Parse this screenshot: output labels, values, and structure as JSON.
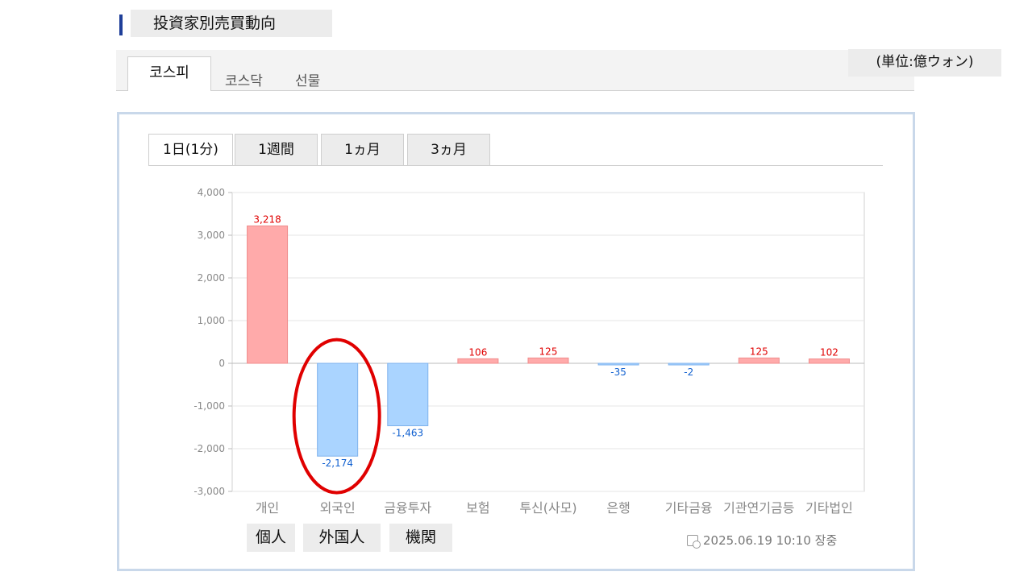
{
  "header": {
    "title": "投資家別売買動向"
  },
  "market_tabs": [
    "코스피",
    "코스닥",
    "선물"
  ],
  "unit_label": "(単位:億ウォン)",
  "period_tabs": [
    "1日(1分)",
    "1週間",
    "1ヵ月",
    "3ヵ月"
  ],
  "captions": [
    "個人",
    "外国人",
    "機関"
  ],
  "timestamp": "2025.06.19 10:10 장중",
  "colors": {
    "positive_fill": "#ffaaaa",
    "negative_fill": "#aad4ff",
    "positive_label": "#e00000",
    "negative_label": "#1060d0",
    "highlight": "#e00000"
  },
  "highlighted_category": "외국인",
  "chart_data": {
    "type": "bar",
    "categories": [
      "개인",
      "외국인",
      "금융투자",
      "보험",
      "투신(사모)",
      "은행",
      "기타금융",
      "기관연기금등",
      "기타법인"
    ],
    "values": [
      3218,
      -2174,
      -1463,
      106,
      125,
      -35,
      -2,
      125,
      102
    ],
    "value_labels": [
      "3,218",
      "-2,174",
      "-1,463",
      "106",
      "125",
      "-35",
      "-2",
      "125",
      "102"
    ],
    "yticks": [
      "4,000",
      "3,000",
      "2,000",
      "1,000",
      "0",
      "-1,000",
      "-2,000",
      "-3,000"
    ],
    "ylim": [
      -3000,
      4000
    ],
    "grid": true
  }
}
